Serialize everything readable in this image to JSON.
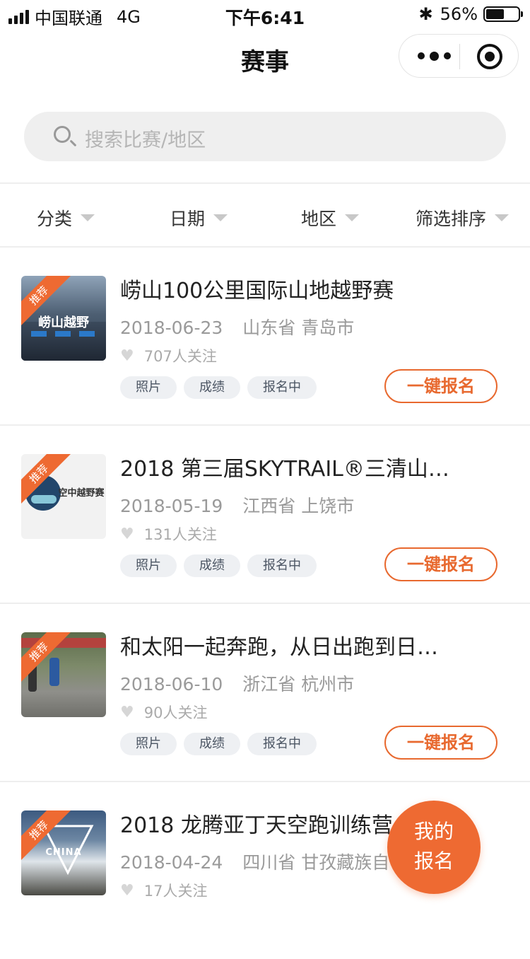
{
  "status_bar": {
    "carrier": "中国联通",
    "network": "4G",
    "time": "下午6:41",
    "battery": "56%"
  },
  "nav": {
    "title": "赛事"
  },
  "search": {
    "placeholder": "搜索比赛/地区"
  },
  "filters": [
    {
      "label": "分类"
    },
    {
      "label": "日期"
    },
    {
      "label": "地区"
    },
    {
      "label": "筛选排序"
    }
  ],
  "events": [
    {
      "badge": "推荐",
      "title": "崂山100公里国际山地越野赛",
      "date": "2018-06-23",
      "location": "山东省 青岛市",
      "followers": "707人关注",
      "tags": [
        "照片",
        "成绩",
        "报名中"
      ],
      "signup": "一键报名",
      "thumb_text": "崂山越野"
    },
    {
      "badge": "推荐",
      "title": "2018 第三届SKYTRAIL®三清山…",
      "date": "2018-05-19",
      "location": "江西省 上饶市",
      "followers": "131人关注",
      "tags": [
        "照片",
        "成绩",
        "报名中"
      ],
      "signup": "一键报名",
      "thumb_text": "空中越野赛"
    },
    {
      "badge": "推荐",
      "title": "和太阳一起奔跑，从日出跑到日…",
      "date": "2018-06-10",
      "location": "浙江省 杭州市",
      "followers": "90人关注",
      "tags": [
        "照片",
        "成绩",
        "报名中"
      ],
      "signup": "一键报名",
      "thumb_text": ""
    },
    {
      "badge": "推荐",
      "title": "2018 龙腾亚丁天空跑训练营",
      "date": "2018-04-24",
      "location": "四川省 甘孜藏族自",
      "followers": "17人关注",
      "tags": [],
      "signup": "",
      "thumb_text": "CHINA"
    }
  ],
  "fab": {
    "line1": "我的",
    "line2": "报名"
  },
  "colors": {
    "accent": "#ee6a32",
    "tag_bg": "#eef0f3",
    "search_bg": "#efefef"
  }
}
